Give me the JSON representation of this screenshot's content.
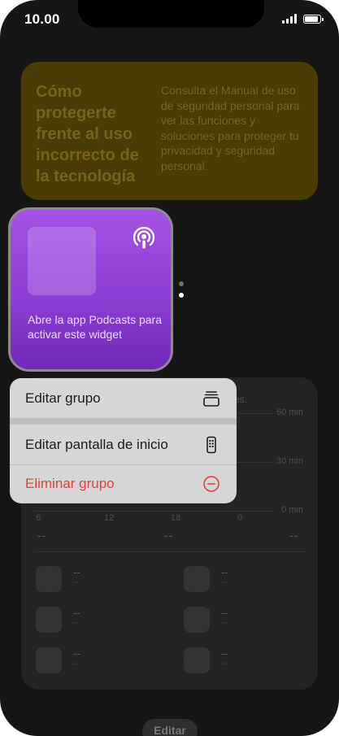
{
  "status_bar": {
    "time": "10.00"
  },
  "safety_widget": {
    "title": "Cómo protegerte frente al uso incorrecto de la tecnología",
    "description": "Consulta el Manual de uso de seguridad personal para ver las funciones y soluciones para proteger tu privacidad y seguridad personal."
  },
  "podcasts_widget": {
    "message": "Abre la app Podcasts para activar este widget",
    "icon": "podcasts-icon"
  },
  "context_menu": {
    "items": [
      {
        "label": "Editar grupo",
        "icon": "stack-icon"
      },
      {
        "label": "Editar pantalla de inicio",
        "icon": "phone-icon"
      },
      {
        "label": "Eliminar grupo",
        "icon": "minus-circle-icon",
        "destructive": true
      }
    ]
  },
  "screen_time_widget": {
    "header_tail": "es.",
    "axis_labels": [
      "60 min",
      "30 min",
      "0 min"
    ],
    "hour_labels": [
      "6",
      "12",
      "18",
      "0"
    ],
    "totals": [
      "--",
      "--",
      "--"
    ],
    "apps": [
      {
        "name": "--",
        "time": "--"
      },
      {
        "name": "--",
        "time": "--"
      },
      {
        "name": "--",
        "time": "--"
      },
      {
        "name": "--",
        "time": "--"
      },
      {
        "name": "--",
        "time": "--"
      },
      {
        "name": "--",
        "time": "--"
      }
    ]
  },
  "edit_button": {
    "label": "Editar"
  },
  "colors": {
    "destructive": "#e0423a",
    "menu_background": "#d6d6d6",
    "podcasts_purple": "#9a4ae0",
    "safety_background": "#4a3c05"
  }
}
